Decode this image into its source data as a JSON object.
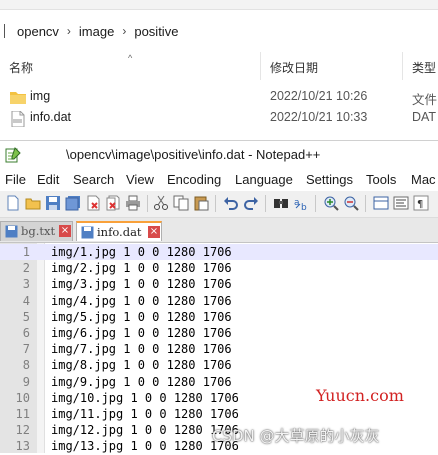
{
  "explorer": {
    "breadcrumb": [
      "opencv",
      "image",
      "positive"
    ],
    "columns": {
      "name": "名称",
      "modified": "修改日期",
      "type": "类型"
    },
    "files": [
      {
        "name": "img",
        "modified": "2022/10/21 10:26",
        "type": "文件",
        "icon": "folder-icon"
      },
      {
        "name": "info.dat",
        "modified": "2022/10/21 10:33",
        "type": "DAT",
        "icon": "dat-file-icon"
      }
    ]
  },
  "notepad": {
    "title": "\\opencv\\image\\positive\\info.dat - Notepad++",
    "menu": [
      "File",
      "Edit",
      "Search",
      "View",
      "Encoding",
      "Language",
      "Settings",
      "Tools",
      "Mac"
    ],
    "tabs": [
      {
        "label": "bg.txt",
        "active": false
      },
      {
        "label": "info.dat",
        "active": true
      }
    ],
    "lines": [
      {
        "num": "1",
        "text": "img/1.jpg 1 0 0 1280 1706"
      },
      {
        "num": "2",
        "text": "img/2.jpg 1 0 0 1280 1706"
      },
      {
        "num": "3",
        "text": "img/3.jpg 1 0 0 1280 1706"
      },
      {
        "num": "4",
        "text": "img/4.jpg 1 0 0 1280 1706"
      },
      {
        "num": "5",
        "text": "img/5.jpg 1 0 0 1280 1706"
      },
      {
        "num": "6",
        "text": "img/6.jpg 1 0 0 1280 1706"
      },
      {
        "num": "7",
        "text": "img/7.jpg 1 0 0 1280 1706"
      },
      {
        "num": "8",
        "text": "img/8.jpg 1 0 0 1280 1706"
      },
      {
        "num": "9",
        "text": "img/9.jpg 1 0 0 1280 1706"
      },
      {
        "num": "10",
        "text": "img/10.jpg 1 0 0 1280 1706"
      },
      {
        "num": "11",
        "text": "img/11.jpg 1 0 0 1280 1706"
      },
      {
        "num": "12",
        "text": "img/12.jpg 1 0 0 1280 1706"
      },
      {
        "num": "13",
        "text": "img/13.jpg 1 0 0 1280 1706"
      }
    ]
  },
  "watermarks": {
    "site": "Yuucn.com",
    "credit": "CSDN @大草原的小灰灰"
  },
  "colors": {
    "current_line": "#e8e8ff",
    "site_watermark": "#d22222",
    "active_tab_accent": "#f9a13a",
    "folder": "#f3c242"
  }
}
